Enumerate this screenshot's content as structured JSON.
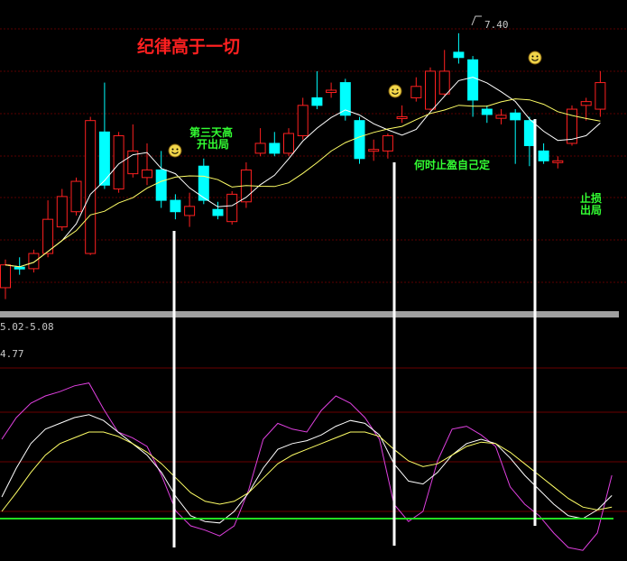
{
  "chart_data": [
    {
      "type": "candlestick",
      "title": "纪律高于一切",
      "range_label": "5.02-5.08",
      "peak_label": "7.40",
      "ylim": [
        3.8,
        7.6
      ],
      "candles": [
        {
          "o": 4.05,
          "c": 4.35,
          "h": 4.42,
          "l": 3.9,
          "dir": "up"
        },
        {
          "o": 4.32,
          "c": 4.3,
          "h": 4.45,
          "l": 4.22,
          "dir": "down"
        },
        {
          "o": 4.3,
          "c": 4.5,
          "h": 4.55,
          "l": 4.25,
          "dir": "up"
        },
        {
          "o": 4.5,
          "c": 4.95,
          "h": 5.2,
          "l": 4.45,
          "dir": "up"
        },
        {
          "o": 4.85,
          "c": 5.25,
          "h": 5.35,
          "l": 4.8,
          "dir": "up"
        },
        {
          "o": 5.05,
          "c": 5.45,
          "h": 5.5,
          "l": 5.0,
          "dir": "up"
        },
        {
          "o": 4.5,
          "c": 6.25,
          "h": 6.3,
          "l": 4.48,
          "dir": "up"
        },
        {
          "o": 6.1,
          "c": 5.4,
          "h": 6.75,
          "l": 5.35,
          "dir": "down"
        },
        {
          "o": 5.35,
          "c": 6.05,
          "h": 6.1,
          "l": 5.3,
          "dir": "up"
        },
        {
          "o": 5.55,
          "c": 5.85,
          "h": 6.2,
          "l": 5.5,
          "dir": "up"
        },
        {
          "o": 5.5,
          "c": 5.6,
          "h": 5.95,
          "l": 5.4,
          "dir": "up"
        },
        {
          "o": 5.6,
          "c": 5.2,
          "h": 5.85,
          "l": 5.1,
          "dir": "down"
        },
        {
          "o": 5.2,
          "c": 5.05,
          "h": 5.28,
          "l": 4.95,
          "dir": "down"
        },
        {
          "o": 5.0,
          "c": 5.12,
          "h": 5.3,
          "l": 4.85,
          "dir": "up"
        },
        {
          "o": 5.65,
          "c": 5.2,
          "h": 5.75,
          "l": 5.15,
          "dir": "down"
        },
        {
          "o": 5.08,
          "c": 5.0,
          "h": 5.18,
          "l": 4.95,
          "dir": "down"
        },
        {
          "o": 4.92,
          "c": 5.28,
          "h": 5.32,
          "l": 4.88,
          "dir": "up"
        },
        {
          "o": 5.18,
          "c": 5.6,
          "h": 5.7,
          "l": 5.1,
          "dir": "up"
        },
        {
          "o": 5.82,
          "c": 5.95,
          "h": 6.15,
          "l": 5.78,
          "dir": "up"
        },
        {
          "o": 5.95,
          "c": 5.82,
          "h": 6.1,
          "l": 5.78,
          "dir": "down"
        },
        {
          "o": 5.82,
          "c": 6.08,
          "h": 6.15,
          "l": 5.78,
          "dir": "up"
        },
        {
          "o": 6.05,
          "c": 6.45,
          "h": 6.55,
          "l": 6.0,
          "dir": "up"
        },
        {
          "o": 6.55,
          "c": 6.45,
          "h": 6.9,
          "l": 6.4,
          "dir": "down"
        },
        {
          "o": 6.62,
          "c": 6.65,
          "h": 6.75,
          "l": 6.55,
          "dir": "up"
        },
        {
          "o": 6.75,
          "c": 6.32,
          "h": 6.8,
          "l": 6.25,
          "dir": "down"
        },
        {
          "o": 6.25,
          "c": 5.75,
          "h": 6.3,
          "l": 5.68,
          "dir": "down"
        },
        {
          "o": 5.85,
          "c": 5.87,
          "h": 6.0,
          "l": 5.72,
          "dir": "up"
        },
        {
          "o": 5.85,
          "c": 6.05,
          "h": 6.08,
          "l": 5.75,
          "dir": "up"
        },
        {
          "o": 6.28,
          "c": 6.3,
          "h": 6.45,
          "l": 6.22,
          "dir": "up"
        },
        {
          "o": 6.55,
          "c": 6.7,
          "h": 6.82,
          "l": 6.5,
          "dir": "up"
        },
        {
          "o": 6.4,
          "c": 6.9,
          "h": 6.95,
          "l": 6.38,
          "dir": "up"
        },
        {
          "o": 6.6,
          "c": 6.9,
          "h": 7.18,
          "l": 6.58,
          "dir": "up"
        },
        {
          "o": 7.15,
          "c": 7.08,
          "h": 7.4,
          "l": 7.0,
          "dir": "down"
        },
        {
          "o": 7.05,
          "c": 6.52,
          "h": 7.1,
          "l": 6.3,
          "dir": "down"
        },
        {
          "o": 6.4,
          "c": 6.33,
          "h": 6.45,
          "l": 6.22,
          "dir": "down"
        },
        {
          "o": 6.28,
          "c": 6.32,
          "h": 6.4,
          "l": 6.2,
          "dir": "up"
        },
        {
          "o": 6.35,
          "c": 6.26,
          "h": 6.4,
          "l": 5.68,
          "dir": "down"
        },
        {
          "o": 6.25,
          "c": 5.92,
          "h": 6.3,
          "l": 5.65,
          "dir": "down"
        },
        {
          "o": 5.85,
          "c": 5.72,
          "h": 5.95,
          "l": 5.68,
          "dir": "down"
        },
        {
          "o": 5.7,
          "c": 5.72,
          "h": 5.78,
          "l": 5.62,
          "dir": "up"
        },
        {
          "o": 5.95,
          "c": 6.4,
          "h": 6.45,
          "l": 5.92,
          "dir": "up"
        },
        {
          "o": 6.45,
          "c": 6.5,
          "h": 6.55,
          "l": 6.25,
          "dir": "up"
        },
        {
          "o": 6.4,
          "c": 6.75,
          "h": 6.9,
          "l": 6.3,
          "dir": "up"
        }
      ],
      "ma_fast_color": "#ffffff",
      "ma_slow_color": "#ffff66",
      "up_color": "#ff2020",
      "down_color": "#00ffff"
    },
    {
      "type": "line",
      "value_label": "4.77",
      "series": [
        {
          "color": "#e040e0",
          "values": [
            0.55,
            0.7,
            0.8,
            0.85,
            0.88,
            0.92,
            0.94,
            0.76,
            0.6,
            0.56,
            0.5,
            0.3,
            0.05,
            -0.05,
            -0.08,
            -0.12,
            -0.05,
            0.2,
            0.55,
            0.66,
            0.62,
            0.6,
            0.75,
            0.85,
            0.8,
            0.7,
            0.55,
            0.1,
            -0.02,
            0.05,
            0.4,
            0.62,
            0.64,
            0.58,
            0.5,
            0.22,
            0.1,
            0.02,
            -0.1,
            -0.2,
            -0.22,
            -0.1,
            0.3
          ]
        },
        {
          "color": "#ffffff",
          "values": [
            0.15,
            0.35,
            0.52,
            0.62,
            0.66,
            0.7,
            0.72,
            0.68,
            0.6,
            0.52,
            0.44,
            0.32,
            0.15,
            0.02,
            -0.02,
            -0.03,
            0.05,
            0.18,
            0.35,
            0.48,
            0.52,
            0.54,
            0.58,
            0.64,
            0.68,
            0.66,
            0.58,
            0.38,
            0.26,
            0.24,
            0.32,
            0.44,
            0.52,
            0.55,
            0.52,
            0.42,
            0.3,
            0.2,
            0.1,
            0.02,
            0.0,
            0.06,
            0.16
          ]
        },
        {
          "color": "#ffff66",
          "values": [
            0.05,
            0.18,
            0.32,
            0.44,
            0.52,
            0.56,
            0.6,
            0.6,
            0.57,
            0.52,
            0.46,
            0.38,
            0.28,
            0.18,
            0.12,
            0.1,
            0.12,
            0.18,
            0.28,
            0.38,
            0.44,
            0.48,
            0.52,
            0.56,
            0.6,
            0.6,
            0.57,
            0.48,
            0.4,
            0.36,
            0.38,
            0.44,
            0.5,
            0.53,
            0.52,
            0.46,
            0.38,
            0.3,
            0.22,
            0.14,
            0.08,
            0.06,
            0.08
          ]
        }
      ]
    }
  ],
  "annotations": {
    "signal1": {
      "line1": "第三天高",
      "line2": "开出局"
    },
    "signal2": {
      "text": "何时止盈自己定"
    },
    "signal3": {
      "line1": "止损",
      "line2": "出局"
    },
    "emoji": "☺"
  }
}
